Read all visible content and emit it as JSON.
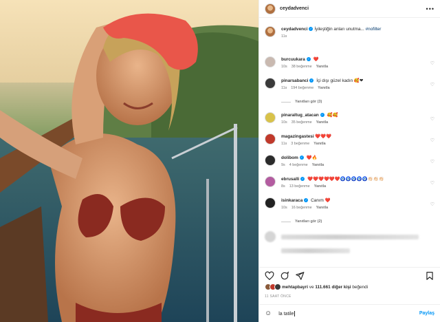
{
  "post": {
    "author": "ceydadvenci",
    "more_icon": "more-horizontal-icon",
    "caption": {
      "username": "ceydadvenci",
      "text": "İyileştiğin anları unutma... ",
      "hashtag": "#nofilter",
      "time": "11s"
    }
  },
  "comments": [
    {
      "username": "burcuukara",
      "text": "❤️",
      "time": "10s",
      "likes": "38 beğenme",
      "reply": "Yanıtla",
      "avatar_color": "#c9b9b0"
    },
    {
      "username": "pinarsabanci",
      "text": "İçi dışı güzel kadın 🥰❤",
      "time": "11s",
      "likes": "194 beğenme",
      "reply": "Yanıtla",
      "avatar_color": "#3a3a3a",
      "view_replies": "Yanıtları gör (3)"
    },
    {
      "username": "pinaraltug_atacan",
      "text": "🥰🥰",
      "time": "10s",
      "likes": "35 beğenme",
      "reply": "Yanıtla",
      "avatar_color": "#d8c24a"
    },
    {
      "username": "magazingastesi",
      "text": "❤️❤️❤️",
      "time": "11s",
      "likes": "3 beğenme",
      "reply": "Yanıtla",
      "avatar_color": "#c0392b"
    },
    {
      "username": "dolibom",
      "text": "❤️🔥",
      "time": "9s",
      "likes": "4 beğenme",
      "reply": "Yanıtla",
      "avatar_color": "#2b2b2b"
    },
    {
      "username": "ebrusalli",
      "text": "❤️❤️❤️❤️❤️❤️🧿🧿🧿🧿🧿👏🏻👏🏻👏🏻",
      "time": "8s",
      "likes": "13 beğenme",
      "reply": "Yanıtla",
      "avatar_color": "#b35ca0"
    },
    {
      "username": "isinkaraca",
      "text": "Canım ❤️",
      "time": "10s",
      "likes": "16 beğenme",
      "reply": "Yanıtla",
      "avatar_color": "#222222",
      "view_replies": "Yanıtları gör (2)"
    }
  ],
  "footer": {
    "liked_by_user": "mehtapbayri",
    "liked_by_rest": "ve 111.661 diğer kişi",
    "liked_suffix": "beğendi",
    "time_ago": "11 SAAT ÖNCE",
    "comment_input_value": "la tatile",
    "post_label": "Paylaş"
  },
  "icons": {
    "like": "heart-icon",
    "comment": "comment-icon",
    "share": "share-icon",
    "save": "bookmark-icon",
    "emoji": "emoji-icon"
  }
}
